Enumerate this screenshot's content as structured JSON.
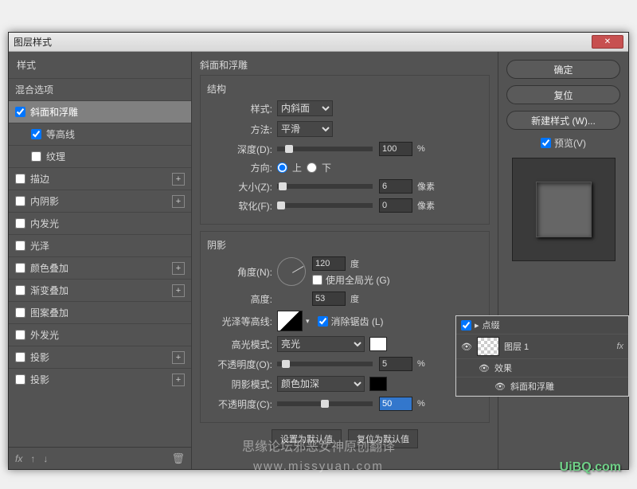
{
  "window": {
    "title": "图层样式"
  },
  "left": {
    "header": "样式",
    "blending": "混合选项",
    "bevel": "斜面和浮雕",
    "contour": "等高线",
    "texture": "纹理",
    "stroke": "描边",
    "innerShadow": "内阴影",
    "innerGlow": "内发光",
    "satin": "光泽",
    "colorOverlay": "颜色叠加",
    "gradOverlay": "渐变叠加",
    "patternOverlay": "图案叠加",
    "outerGlow": "外发光",
    "dropShadow": "投影",
    "dropShadow2": "投影"
  },
  "center": {
    "title": "斜面和浮雕",
    "structure": "结构",
    "styleLabel": "样式:",
    "styleValue": "内斜面",
    "techniqueLabel": "方法:",
    "techniqueValue": "平滑",
    "depthLabel": "深度(D):",
    "depthValue": "100",
    "depthUnit": "%",
    "directionLabel": "方向:",
    "up": "上",
    "down": "下",
    "sizeLabel": "大小(Z):",
    "sizeValue": "6",
    "sizeUnit": "像素",
    "softenLabel": "软化(F):",
    "softenValue": "0",
    "softenUnit": "像素",
    "shading": "阴影",
    "angleLabel": "角度(N):",
    "angleValue": "120",
    "angleUnit": "度",
    "globalLight": "使用全局光 (G)",
    "altitudeLabel": "高度:",
    "altitudeValue": "53",
    "altitudeUnit": "度",
    "glossLabel": "光泽等高线:",
    "antiAlias": "消除锯齿 (L)",
    "highlightModeLabel": "高光模式:",
    "highlightModeValue": "亮光",
    "hlOpacityLabel": "不透明度(O):",
    "hlOpacityValue": "5",
    "hlOpacityUnit": "%",
    "shadowModeLabel": "阴影模式:",
    "shadowModeValue": "颜色加深",
    "shOpacityLabel": "不透明度(C):",
    "shOpacityValue": "50",
    "shOpacityUnit": "%",
    "makeDefault": "设置为默认值",
    "resetDefault": "复位为默认值"
  },
  "right": {
    "ok": "确定",
    "cancel": "复位",
    "newStyle": "新建样式 (W)...",
    "preview": "预览(V)"
  },
  "layers": {
    "panelTitle": "点缀",
    "layerName": "图层 1",
    "effects": "效果",
    "bevelEffect": "斜面和浮雕"
  },
  "watermark": {
    "line1": "思缘论坛邪恶女神原创翻译",
    "line2": "www.missyuan.com",
    "brand": "UiBQ.com"
  },
  "icons": {
    "fx": "fx",
    "plus": "+",
    "dropdown": "▾",
    "arrowUp": "↑",
    "arrowDown": "↓",
    "trash": "🗑",
    "eye": "👁",
    "folder": "▸",
    "close": "✕"
  }
}
